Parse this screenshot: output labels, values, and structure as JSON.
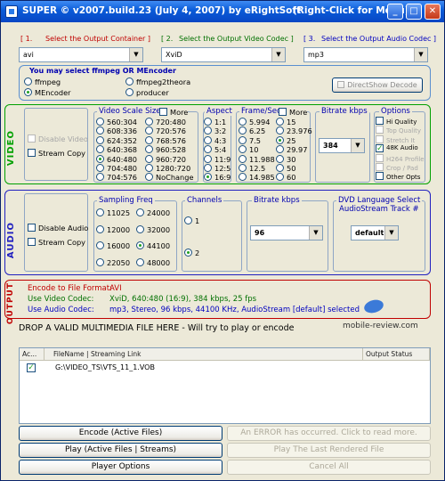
{
  "window": {
    "title": "SUPER © v2007.build.23 (July 4, 2007) by eRightSoft",
    "hint": "(Right-Click for Menu)"
  },
  "steps": {
    "s1": {
      "num": "[ 1.",
      "label": "Select the Output Container ]",
      "value": "avi"
    },
    "s2": {
      "num": "[ 2.",
      "label": "Select the Output Video Codec ]",
      "value": "XviD"
    },
    "s3": {
      "num": "[ 3.",
      "label": "Select the Output Audio Codec ]",
      "value": "mp3"
    }
  },
  "encoder": {
    "title": "You may select ffmpeg OR MEncoder",
    "options": [
      "ffmpeg",
      "ffmpeg2theora",
      "MEncoder",
      "producer"
    ],
    "selected": "MEncoder",
    "directshow": "DirectShow Decode"
  },
  "video": {
    "section": "VIDEO",
    "disable": "Disable Video",
    "stream_copy": "Stream Copy",
    "scale_title": "Video Scale Size",
    "scale_more": "More",
    "scale_col1": [
      "560:304",
      "608:336",
      "624:352",
      "640:368",
      "640:480",
      "704:480",
      "704:576"
    ],
    "scale_col2": [
      "720:480",
      "720:576",
      "768:576",
      "960:528",
      "960:720",
      "1280:720",
      "NoChange"
    ],
    "scale_selected": "640:480",
    "aspect_title": "Aspect",
    "aspect": [
      "1:1",
      "3:2",
      "4:3",
      "5:4",
      "11:9",
      "12:5",
      "16:9"
    ],
    "aspect_selected": "16:9",
    "fps_title": "Frame/Sec",
    "fps_more": "More",
    "fps_col1": [
      "5.994",
      "6.25",
      "7.5",
      "10",
      "11.988",
      "12.5",
      "14.985"
    ],
    "fps_col2": [
      "15",
      "23.976",
      "25",
      "29.97",
      "30",
      "50",
      "60"
    ],
    "fps_selected": "25",
    "bitrate_title": "Bitrate  kbps",
    "bitrate": "384",
    "options_title": "Options",
    "options": [
      {
        "label": "Hi Quality",
        "state": "off"
      },
      {
        "label": "Top Quality",
        "state": "dis"
      },
      {
        "label": "Stretch It",
        "state": "dis"
      },
      {
        "label": "48K Audio",
        "state": "on"
      },
      {
        "label": "H264 Profile",
        "state": "dis"
      },
      {
        "label": "Crop / Pad",
        "state": "dis"
      },
      {
        "label": "Other Opts",
        "state": "off"
      }
    ]
  },
  "audio": {
    "section": "AUDIO",
    "disable": "Disable Audio",
    "stream_copy": "Stream Copy",
    "freq_title": "Sampling Freq",
    "freq": [
      "11025",
      "24000",
      "12000",
      "32000",
      "16000",
      "44100",
      "22050",
      "48000"
    ],
    "freq_selected": "44100",
    "channels_title": "Channels",
    "channels": [
      "1",
      "2"
    ],
    "channels_selected": "2",
    "bitrate_title": "Bitrate  kbps",
    "bitrate": "96",
    "dvd_title": "DVD Language Select",
    "dvd_sub": "AudioStream  Track #",
    "dvd_value": "default"
  },
  "output": {
    "section": "OUTPUT",
    "rows": [
      {
        "label": "Encode to File Format:",
        "value": "AVI"
      },
      {
        "label": "Use Video Codec:",
        "value": "XviD,  640:480 (16:9),  384 kbps,  25 fps"
      },
      {
        "label": "Use Audio Codec:",
        "value": "mp3,  Stereo,  96 kbps,  44100 KHz,  AudioStream [default] selected"
      }
    ],
    "watermark": "mobile-review.com"
  },
  "drop": "DROP A VALID MULTIMEDIA FILE HERE - Will try to play or encode",
  "files": {
    "headers": [
      "Ac...",
      "FileName  |  Streaming Link",
      "Output Status"
    ],
    "rows": [
      {
        "checked": true,
        "name": "G:\\VIDEO_TS\\VTS_11_1.VOB",
        "status": ""
      }
    ]
  },
  "buttons": {
    "encode": "Encode (Active Files)",
    "error": "An ERROR has occurred. Click to read more.",
    "play": "Play (Active Files | Streams)",
    "play_last": "Play The Last Rendered File",
    "player": "Player Options",
    "cancel": "Cancel All"
  }
}
